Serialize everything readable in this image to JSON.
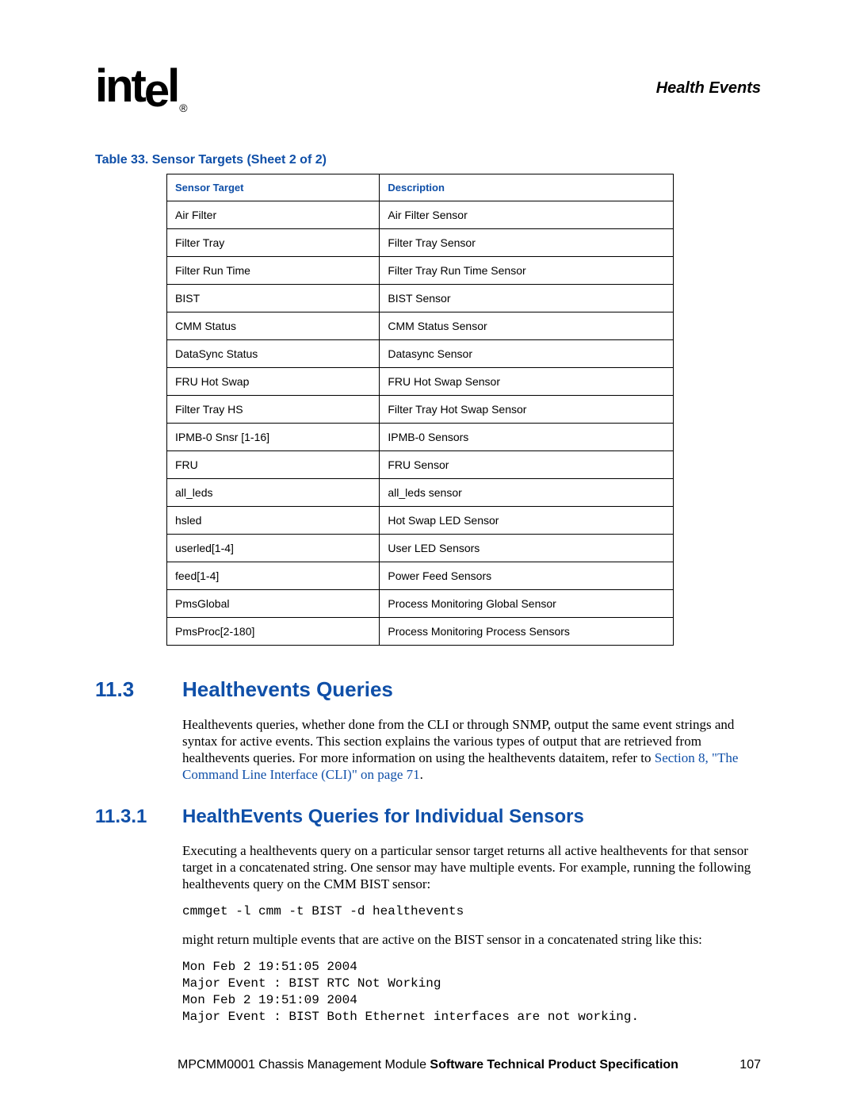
{
  "header": {
    "logo_text": "intel",
    "right_title": "Health Events"
  },
  "table": {
    "caption": "Table 33. Sensor Targets  (Sheet 2 of 2)",
    "columns": [
      "Sensor Target",
      "Description"
    ],
    "rows": [
      [
        "Air Filter",
        "Air Filter Sensor"
      ],
      [
        "Filter Tray",
        "Filter Tray Sensor"
      ],
      [
        "Filter Run Time",
        "Filter Tray Run Time Sensor"
      ],
      [
        "BIST",
        "BIST Sensor"
      ],
      [
        "CMM Status",
        "CMM Status Sensor"
      ],
      [
        "DataSync Status",
        "Datasync Sensor"
      ],
      [
        "FRU Hot Swap",
        "FRU Hot Swap Sensor"
      ],
      [
        "Filter Tray HS",
        "Filter Tray Hot Swap Sensor"
      ],
      [
        "IPMB-0 Snsr [1-16]",
        "IPMB-0 Sensors"
      ],
      [
        "FRU",
        "FRU Sensor"
      ],
      [
        "all_leds",
        "all_leds sensor"
      ],
      [
        "hsled",
        "Hot Swap LED Sensor"
      ],
      [
        "userled[1-4]",
        "User LED Sensors"
      ],
      [
        "feed[1-4]",
        "Power Feed Sensors"
      ],
      [
        "PmsGlobal",
        "Process Monitoring Global Sensor"
      ],
      [
        "PmsProc[2-180]",
        "Process Monitoring Process Sensors"
      ]
    ]
  },
  "section_11_3": {
    "num": "11.3",
    "title": "Healthevents Queries",
    "para1_a": "Healthevents queries, whether done from the CLI or through SNMP, output the same event strings and syntax for active events. This section explains the various types of output that are retrieved from healthevents queries. For more information on using the healthevents dataitem, refer to ",
    "para1_link": "Section 8, \"The Command Line Interface (CLI)\" on page 71",
    "para1_b": "."
  },
  "section_11_3_1": {
    "num": "11.3.1",
    "title": "HealthEvents Queries for Individual Sensors",
    "para1": "Executing a healthevents query on a particular sensor target returns all active healthevents for that sensor target in a concatenated string. One sensor may have multiple events. For example, running the following healthevents query on the CMM BIST sensor:",
    "code1": "cmmget -l cmm -t BIST -d healthevents",
    "para2": "might return multiple events that are active on the BIST sensor in a concatenated string like this:",
    "code2": "Mon Feb 2 19:51:05 2004\nMajor Event : BIST RTC Not Working\nMon Feb 2 19:51:09 2004\nMajor Event : BIST Both Ethernet interfaces are not working."
  },
  "footer": {
    "text_a": "MPCMM0001 Chassis Management Module ",
    "text_b": "Software Technical Product Specification",
    "page": "107"
  }
}
